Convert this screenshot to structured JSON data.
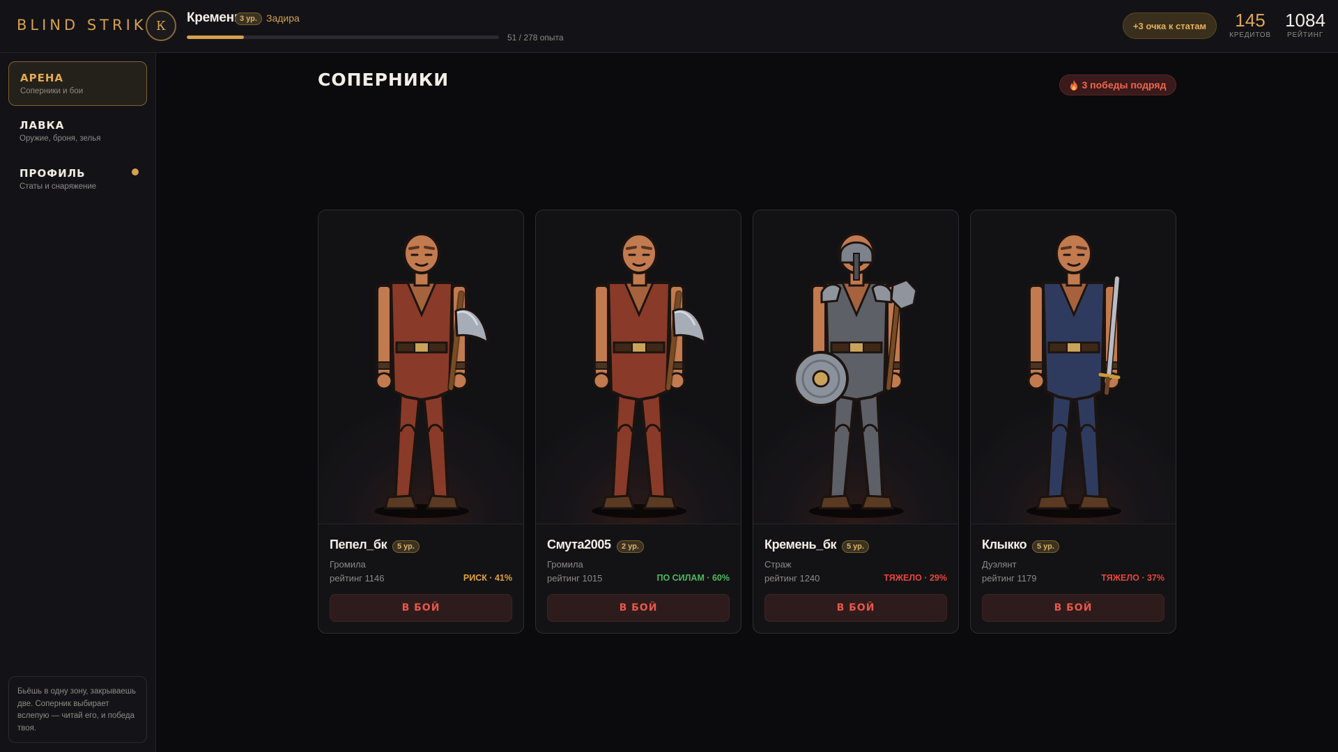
{
  "app": {
    "logo": "BLIND STRIKE"
  },
  "player": {
    "avatar_letter": "К",
    "name": "Кремень",
    "level": "3 ур.",
    "class": "Задира",
    "xp_text": "51 / 278 опыта",
    "xp_current": 51,
    "xp_total": 278
  },
  "header": {
    "stat_points_button": "+3 очка к статам",
    "credits_value": "145",
    "credits_label": "КРЕДИТОВ",
    "rating_value": "1084",
    "rating_label": "РЕЙТИНГ"
  },
  "sidebar": {
    "items": [
      {
        "title": "АРЕНА",
        "subtitle": "Соперники и бои",
        "active": true
      },
      {
        "title": "ЛАВКА",
        "subtitle": "Оружие, броня, зелья",
        "active": false
      },
      {
        "title": "ПРОФИЛЬ",
        "subtitle": "Статы и снаряжение",
        "active": false,
        "notification_dot": true
      }
    ],
    "hint": "Бьёшь в одну зону, закрываешь две. Соперник выбирает вслепую — читай его, и победа твоя."
  },
  "main": {
    "title": "СОПЕРНИКИ",
    "streak": "3 победы подряд",
    "streak_icon": "flame-icon",
    "fight_label": "В БОЙ",
    "opponents": [
      {
        "name": "Пепел_бк",
        "level": "5 ур.",
        "class": "Громила",
        "rating": "рейтинг 1146",
        "odds": "РИСК · 41%",
        "odds_color": "#e3a23c",
        "weapon": "axe",
        "armor_color": "#8a3a28"
      },
      {
        "name": "Смута2005",
        "level": "2 ур.",
        "class": "Громила",
        "rating": "рейтинг 1015",
        "odds": "ПО СИЛАМ · 60%",
        "odds_color": "#4cbb5e",
        "weapon": "axe",
        "armor_color": "#8a3a28"
      },
      {
        "name": "Кремень_бк",
        "level": "5 ур.",
        "class": "Страж",
        "rating": "рейтинг 1240",
        "odds": "ТЯЖЕЛО · 29%",
        "odds_color": "#e8453a",
        "weapon": "shield-mace",
        "armor_color": "#5e6068"
      },
      {
        "name": "Клыкко",
        "level": "5 ур.",
        "class": "Дуэлянт",
        "rating": "рейтинг 1179",
        "odds": "ТЯЖЕЛО · 37%",
        "odds_color": "#e8453a",
        "weapon": "sword",
        "armor_color": "#2f3b5e"
      }
    ]
  }
}
